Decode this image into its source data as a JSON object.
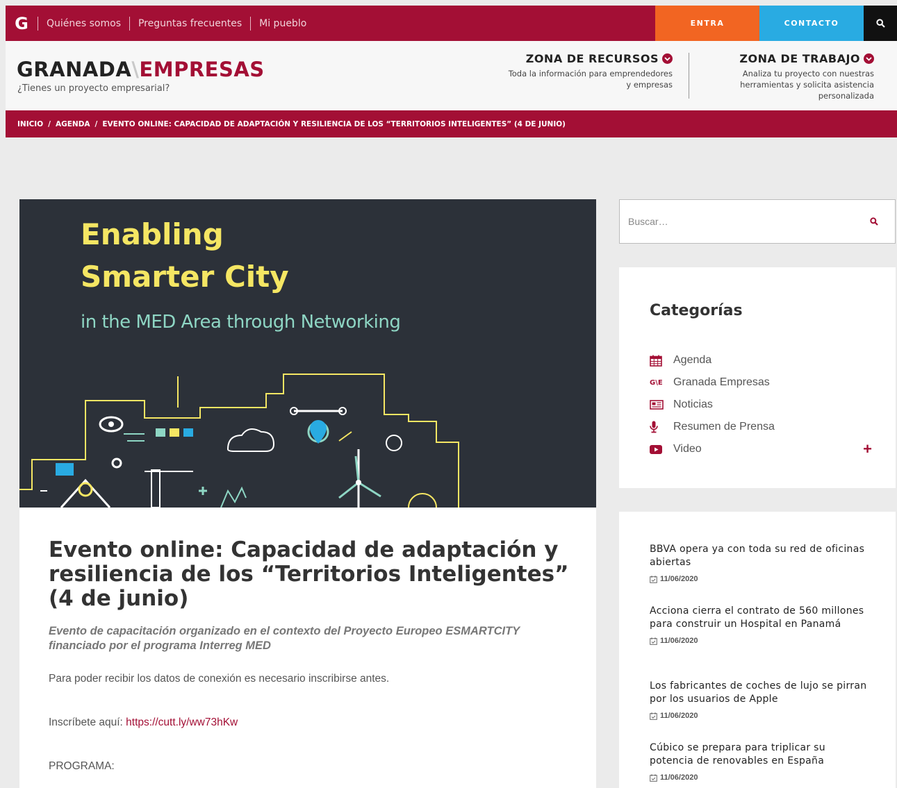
{
  "topbar": {
    "logo": "G",
    "nav": [
      "Quiénes somos",
      "Preguntas frecuentes",
      "Mi pueblo"
    ],
    "entra": "ENTRA",
    "contacto": "CONTACTO"
  },
  "header": {
    "brand_left": "GRANADA",
    "brand_sep": "\\",
    "brand_right": "EMPRESAS",
    "tagline": "¿Tienes un proyecto empresarial?",
    "zone1_title": "ZONA DE RECURSOS",
    "zone1_desc": "Toda la información para emprendedores y empresas",
    "zone2_title": "ZONA DE TRABAJO",
    "zone2_desc": "Analiza tu proyecto con nuestras herramientas y solicita asistencia personalizada"
  },
  "breadcrumb": [
    "INICIO",
    "AGENDA",
    "EVENTO ONLINE: CAPACIDAD DE ADAPTACIÓN Y RESILIENCIA DE LOS “TERRITORIOS INTELIGENTES” (4 DE JUNIO)"
  ],
  "hero": {
    "line1": "Enabling",
    "line2": "Smarter City",
    "subtitle": "in the MED Area through Networking"
  },
  "article": {
    "title": "Evento online: Capacidad de adaptación y resiliencia de los “Territorios Inteligentes” (4 de junio)",
    "lead": "Evento de capacitación organizado en el contexto del Proyecto Europeo ESMARTCITY financiado por el programa Interreg MED",
    "p1": "Para poder recibir los datos de conexión es necesario inscribirse antes.",
    "p2_label": "Inscríbete aquí: ",
    "p2_link": "https://cutt.ly/ww73hKw",
    "p3": "PROGRAMA:"
  },
  "sidebar": {
    "search_placeholder": "Buscar…",
    "categories_title": "Categorías",
    "categories": [
      {
        "label": "Agenda",
        "icon": "calendar-icon"
      },
      {
        "label": "Granada Empresas",
        "icon": "ge-logo-icon"
      },
      {
        "label": "Noticias",
        "icon": "newspaper-icon"
      },
      {
        "label": "Resumen de Prensa",
        "icon": "microphone-icon"
      },
      {
        "label": "Video",
        "icon": "youtube-icon"
      }
    ],
    "news": [
      {
        "title": "BBVA opera ya con toda su red de oficinas abiertas",
        "date": "11/06/2020"
      },
      {
        "title": "Acciona cierra el contrato de 560 millones para construir un Hospital en Panamá",
        "date": "11/06/2020"
      },
      {
        "title": "Los fabricantes de coches de lujo se pirran por los usuarios de Apple",
        "date": "11/06/2020"
      },
      {
        "title": "Cúbico se prepara para triplicar su potencia de renovables en España",
        "date": "11/06/2020"
      }
    ]
  },
  "colors": {
    "brand": "#a30f35",
    "entra": "#f26522",
    "contacto": "#29abe2",
    "hero_bg": "#2c3139",
    "hero_yellow": "#f5e663",
    "hero_teal": "#8ed6c4"
  }
}
